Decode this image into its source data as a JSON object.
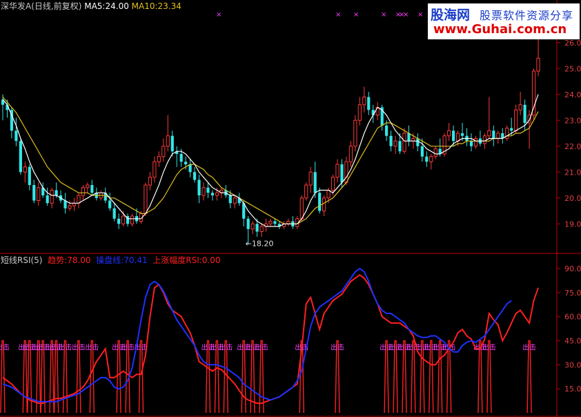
{
  "header": {
    "stock_name": "深华发A",
    "period": "(日线,前复权)",
    "ma5_label": "MA5:",
    "ma5_value": "24.00",
    "ma10_label": "MA10:",
    "ma10_value": "23.34"
  },
  "indicator_header": {
    "name": "短线RSI(5)",
    "trend_label": "趋势:",
    "trend_value": "78.00",
    "control_label": "操盘线:",
    "control_value": "70.41",
    "rise_label": "上涨幅度RSI:",
    "rise_value": "0.00"
  },
  "low_annotation": "←18.20",
  "exit_label": "出击",
  "logo": {
    "line1": "股海网",
    "line1b": "股票软件资源分享",
    "line2": "www.Guhai.com.cn"
  },
  "colors": {
    "up": "#ff3a3a",
    "down": "#33e6e6",
    "ma5": "#ffffff",
    "ma10": "#e0c020",
    "rsi_trend": "#ff2020",
    "rsi_control": "#2030ff",
    "exit_marker": "#ff40ff",
    "axis": "#c00000"
  },
  "chart_data": [
    {
      "type": "candlestick",
      "series": [
        {
          "name": "MA5",
          "value_label": "24.00"
        },
        {
          "name": "MA10",
          "value_label": "23.34"
        }
      ],
      "ylim": [
        18.1,
        26.9
      ],
      "y_ticks": [
        19.0,
        20.0,
        21.0,
        22.0,
        23.0,
        24.0,
        25.0,
        26.0
      ],
      "annotations": [
        {
          "text": "←18.20",
          "value": 18.2
        }
      ],
      "candles": [
        [
          23.8,
          24.0,
          23.0,
          23.6
        ],
        [
          23.6,
          23.8,
          23.1,
          23.4
        ],
        [
          23.4,
          23.5,
          22.3,
          22.6
        ],
        [
          22.6,
          23.1,
          22.0,
          22.2
        ],
        [
          22.2,
          22.3,
          20.9,
          21.0
        ],
        [
          21.0,
          21.4,
          20.6,
          21.2
        ],
        [
          21.2,
          21.3,
          20.3,
          20.5
        ],
        [
          20.5,
          20.7,
          19.8,
          19.9
        ],
        [
          19.9,
          20.6,
          19.7,
          20.4
        ],
        [
          20.4,
          20.6,
          20.0,
          20.1
        ],
        [
          20.1,
          20.4,
          19.7,
          19.8
        ],
        [
          19.8,
          20.4,
          19.6,
          20.3
        ],
        [
          20.3,
          20.6,
          20.0,
          20.1
        ],
        [
          20.1,
          20.3,
          19.8,
          19.9
        ],
        [
          19.9,
          20.2,
          19.4,
          19.6
        ],
        [
          19.6,
          19.9,
          19.5,
          19.7
        ],
        [
          19.7,
          20.0,
          19.5,
          19.8
        ],
        [
          19.8,
          20.2,
          19.6,
          20.1
        ],
        [
          20.1,
          20.5,
          19.9,
          20.4
        ],
        [
          20.4,
          20.6,
          20.2,
          20.5
        ],
        [
          20.5,
          20.7,
          20.1,
          20.2
        ],
        [
          20.2,
          20.4,
          19.9,
          20.0
        ],
        [
          20.0,
          20.3,
          19.9,
          20.2
        ],
        [
          20.2,
          20.4,
          19.8,
          19.9
        ],
        [
          19.9,
          20.2,
          19.5,
          19.6
        ],
        [
          19.6,
          19.8,
          19.1,
          19.2
        ],
        [
          19.2,
          19.4,
          18.8,
          19.0
        ],
        [
          19.0,
          19.5,
          18.9,
          19.3
        ],
        [
          19.3,
          19.4,
          18.9,
          19.0
        ],
        [
          19.0,
          19.4,
          18.9,
          19.3
        ],
        [
          19.3,
          19.6,
          19.0,
          19.1
        ],
        [
          19.1,
          19.5,
          19.0,
          19.4
        ],
        [
          19.4,
          20.6,
          19.3,
          20.5
        ],
        [
          20.5,
          21.0,
          20.3,
          20.8
        ],
        [
          20.8,
          21.6,
          20.6,
          21.4
        ],
        [
          21.4,
          21.8,
          21.2,
          21.6
        ],
        [
          21.6,
          22.3,
          21.4,
          22.0
        ],
        [
          22.0,
          23.2,
          21.8,
          22.4
        ],
        [
          22.4,
          22.6,
          21.6,
          21.8
        ],
        [
          21.8,
          22.0,
          21.2,
          21.7
        ],
        [
          21.7,
          21.9,
          21.2,
          21.4
        ],
        [
          21.4,
          21.6,
          21.1,
          21.3
        ],
        [
          21.3,
          21.5,
          20.8,
          21.0
        ],
        [
          21.0,
          21.2,
          20.6,
          20.7
        ],
        [
          20.7,
          20.9,
          19.8,
          20.1
        ],
        [
          20.1,
          20.6,
          19.9,
          20.4
        ],
        [
          20.4,
          20.6,
          20.0,
          20.2
        ],
        [
          20.2,
          20.3,
          19.9,
          20.1
        ],
        [
          20.1,
          20.4,
          19.9,
          20.2
        ],
        [
          20.2,
          20.4,
          20.0,
          20.3
        ],
        [
          20.3,
          20.5,
          20.0,
          20.1
        ],
        [
          20.1,
          20.3,
          19.6,
          19.8
        ],
        [
          19.8,
          20.1,
          19.6,
          20.0
        ],
        [
          20.0,
          20.2,
          19.7,
          19.8
        ],
        [
          19.8,
          19.9,
          18.9,
          19.2
        ],
        [
          19.2,
          19.3,
          18.2,
          18.8
        ],
        [
          18.8,
          19.1,
          18.6,
          19.0
        ],
        [
          19.0,
          19.2,
          18.5,
          18.7
        ],
        [
          18.7,
          19.0,
          18.5,
          18.9
        ],
        [
          18.9,
          19.2,
          18.7,
          19.0
        ],
        [
          19.0,
          19.2,
          18.9,
          19.1
        ],
        [
          19.1,
          19.2,
          18.9,
          19.0
        ],
        [
          19.0,
          19.1,
          18.8,
          18.9
        ],
        [
          18.9,
          19.1,
          18.8,
          19.0
        ],
        [
          19.0,
          19.2,
          18.9,
          19.1
        ],
        [
          19.1,
          19.3,
          18.8,
          18.9
        ],
        [
          18.9,
          19.3,
          18.8,
          19.2
        ],
        [
          19.2,
          20.1,
          19.1,
          20.0
        ],
        [
          20.0,
          20.6,
          19.9,
          20.5
        ],
        [
          20.5,
          21.2,
          20.2,
          21.0
        ],
        [
          21.0,
          21.4,
          20.0,
          20.2
        ],
        [
          20.2,
          20.4,
          19.4,
          19.5
        ],
        [
          19.5,
          20.1,
          19.3,
          20.0
        ],
        [
          20.0,
          20.4,
          19.8,
          20.3
        ],
        [
          20.3,
          20.9,
          20.1,
          20.8
        ],
        [
          20.8,
          21.5,
          20.6,
          21.3
        ],
        [
          21.3,
          21.5,
          20.4,
          20.6
        ],
        [
          20.6,
          21.6,
          20.5,
          21.4
        ],
        [
          21.4,
          22.2,
          21.2,
          22.0
        ],
        [
          22.0,
          23.2,
          21.8,
          23.0
        ],
        [
          23.0,
          23.9,
          22.8,
          23.6
        ],
        [
          23.6,
          24.3,
          23.3,
          23.9
        ],
        [
          23.9,
          24.1,
          23.2,
          23.4
        ],
        [
          23.4,
          23.6,
          22.9,
          23.2
        ],
        [
          23.2,
          23.7,
          23.0,
          23.5
        ],
        [
          23.5,
          23.6,
          22.6,
          22.8
        ],
        [
          22.8,
          23.0,
          22.2,
          22.4
        ],
        [
          22.4,
          22.6,
          21.8,
          22.0
        ],
        [
          22.0,
          22.4,
          21.7,
          22.2
        ],
        [
          22.2,
          22.5,
          21.7,
          21.8
        ],
        [
          21.8,
          22.7,
          21.7,
          22.5
        ],
        [
          22.5,
          22.8,
          22.0,
          22.2
        ],
        [
          22.2,
          22.5,
          21.9,
          22.3
        ],
        [
          22.3,
          22.5,
          21.8,
          22.0
        ],
        [
          22.0,
          22.3,
          21.4,
          21.6
        ],
        [
          21.6,
          21.8,
          21.2,
          21.4
        ],
        [
          21.4,
          21.7,
          21.1,
          21.6
        ],
        [
          21.6,
          22.0,
          21.5,
          21.9
        ],
        [
          21.9,
          22.3,
          21.6,
          21.7
        ],
        [
          21.7,
          22.5,
          21.6,
          22.4
        ],
        [
          22.4,
          22.9,
          22.2,
          22.6
        ],
        [
          22.6,
          22.8,
          22.0,
          22.2
        ],
        [
          22.2,
          22.6,
          22.0,
          22.5
        ],
        [
          22.5,
          22.9,
          22.2,
          22.4
        ],
        [
          22.4,
          22.7,
          22.0,
          22.2
        ],
        [
          22.2,
          22.5,
          21.8,
          22.0
        ],
        [
          22.0,
          22.4,
          21.9,
          22.3
        ],
        [
          22.3,
          22.6,
          22.0,
          22.1
        ],
        [
          22.1,
          22.5,
          21.9,
          22.4
        ],
        [
          22.4,
          23.9,
          22.3,
          22.6
        ],
        [
          22.6,
          22.8,
          22.0,
          22.3
        ],
        [
          22.3,
          22.6,
          22.1,
          22.5
        ],
        [
          22.5,
          22.7,
          22.1,
          22.3
        ],
        [
          22.3,
          22.8,
          22.2,
          22.7
        ],
        [
          22.7,
          23.1,
          22.4,
          22.6
        ],
        [
          22.6,
          23.6,
          22.5,
          23.4
        ],
        [
          23.4,
          24.1,
          23.2,
          23.6
        ],
        [
          23.6,
          23.8,
          22.6,
          22.9
        ],
        [
          22.9,
          23.4,
          21.9,
          23.2
        ],
        [
          23.2,
          25.0,
          23.0,
          24.9
        ],
        [
          24.9,
          26.9,
          24.7,
          25.4
        ]
      ],
      "ma5": [
        23.8,
        23.6,
        23.2,
        22.8,
        22.3,
        21.9,
        21.4,
        21.0,
        20.7,
        20.4,
        20.2,
        20.1,
        20.1,
        20.0,
        19.9,
        19.8,
        19.8,
        19.8,
        19.9,
        20.0,
        20.1,
        20.2,
        20.2,
        20.2,
        20.0,
        19.8,
        19.6,
        19.4,
        19.2,
        19.2,
        19.2,
        19.2,
        19.4,
        19.7,
        20.1,
        20.5,
        21.0,
        21.4,
        21.7,
        21.8,
        21.8,
        21.7,
        21.5,
        21.3,
        21.0,
        20.8,
        20.6,
        20.4,
        20.3,
        20.2,
        20.2,
        20.1,
        20.1,
        20.0,
        19.8,
        19.5,
        19.3,
        19.1,
        19.0,
        18.9,
        18.9,
        18.9,
        18.9,
        19.0,
        19.0,
        19.0,
        19.0,
        19.2,
        19.5,
        19.9,
        20.2,
        20.3,
        20.3,
        20.3,
        20.2,
        20.4,
        20.6,
        20.8,
        21.1,
        21.5,
        22.0,
        22.5,
        22.9,
        23.2,
        23.5,
        23.4,
        23.2,
        22.9,
        22.6,
        22.4,
        22.2,
        22.2,
        22.2,
        22.2,
        22.1,
        21.9,
        21.8,
        21.7,
        21.7,
        21.8,
        21.9,
        22.1,
        22.2,
        22.3,
        22.3,
        22.3,
        22.2,
        22.2,
        22.2,
        22.3,
        22.3,
        22.3,
        22.3,
        22.4,
        22.5,
        22.6,
        22.7,
        22.8,
        23.0,
        23.5,
        24.0
      ],
      "ma10": [
        23.9,
        23.7,
        23.5,
        23.3,
        23.0,
        22.7,
        22.4,
        22.1,
        21.8,
        21.5,
        21.2,
        21.0,
        20.8,
        20.6,
        20.5,
        20.4,
        20.3,
        20.2,
        20.2,
        20.2,
        20.1,
        20.1,
        20.1,
        20.1,
        20.0,
        20.0,
        19.9,
        19.8,
        19.7,
        19.6,
        19.5,
        19.4,
        19.4,
        19.5,
        19.6,
        19.8,
        20.0,
        20.3,
        20.6,
        20.9,
        21.1,
        21.2,
        21.3,
        21.3,
        21.2,
        21.1,
        20.9,
        20.8,
        20.6,
        20.4,
        20.3,
        20.2,
        20.1,
        20.0,
        19.9,
        19.8,
        19.7,
        19.6,
        19.5,
        19.4,
        19.3,
        19.2,
        19.1,
        19.0,
        19.0,
        19.0,
        19.0,
        19.1,
        19.2,
        19.4,
        19.6,
        19.7,
        19.8,
        19.9,
        20.0,
        20.2,
        20.4,
        20.6,
        20.9,
        21.2,
        21.5,
        21.8,
        22.1,
        22.4,
        22.7,
        22.8,
        22.9,
        22.9,
        22.8,
        22.7,
        22.6,
        22.5,
        22.4,
        22.3,
        22.2,
        22.1,
        22.0,
        22.0,
        22.0,
        22.0,
        22.0,
        22.0,
        22.1,
        22.1,
        22.2,
        22.2,
        22.2,
        22.2,
        22.2,
        22.2,
        22.3,
        22.3,
        22.3,
        22.4,
        22.4,
        22.5,
        22.5,
        22.6,
        22.7,
        23.0,
        23.34
      ]
    },
    {
      "type": "line",
      "ylim": [
        0,
        93
      ],
      "y_ticks": [
        15.0,
        30.0,
        45.0,
        60.0,
        75.0,
        90.0
      ],
      "series": [
        {
          "name": "趋势",
          "color": "#ff2020",
          "values": [
            22,
            20,
            18,
            15,
            12,
            10,
            8,
            7,
            6,
            6,
            7,
            8,
            9,
            9,
            10,
            11,
            12,
            14,
            16,
            20,
            26,
            32,
            36,
            40,
            22,
            22,
            24,
            26,
            24,
            22,
            24,
            24,
            36,
            60,
            78,
            80,
            75,
            68,
            64,
            62,
            60,
            55,
            50,
            42,
            32,
            30,
            28,
            26,
            28,
            27,
            24,
            21,
            18,
            14,
            10,
            8,
            7,
            6,
            6,
            7,
            8,
            9,
            10,
            12,
            14,
            16,
            18,
            40,
            68,
            72,
            62,
            52,
            62,
            66,
            70,
            72,
            74,
            78,
            82,
            84,
            86,
            84,
            80,
            74,
            68,
            60,
            58,
            56,
            56,
            56,
            54,
            52,
            48,
            38,
            34,
            32,
            30,
            30,
            34,
            36,
            40,
            44,
            50,
            52,
            48,
            46,
            40,
            40,
            46,
            62,
            58,
            55,
            45,
            50,
            56,
            62,
            64,
            60,
            56,
            70,
            78
          ]
        },
        {
          "name": "操盘线",
          "color": "#2030ff",
          "values": [
            18,
            17,
            16,
            14,
            12,
            10,
            9,
            8,
            7,
            7,
            7,
            7,
            7,
            8,
            9,
            10,
            11,
            12,
            14,
            16,
            18,
            20,
            22,
            22,
            20,
            16,
            15,
            16,
            20,
            28,
            42,
            58,
            72,
            80,
            82,
            80,
            76,
            70,
            64,
            58,
            54,
            50,
            46,
            42,
            36,
            32,
            30,
            30,
            30,
            29,
            28,
            26,
            24,
            22,
            18,
            16,
            14,
            12,
            10,
            9,
            8,
            9,
            10,
            12,
            14,
            16,
            20,
            26,
            40,
            54,
            62,
            66,
            68,
            70,
            72,
            74,
            76,
            80,
            84,
            88,
            90,
            88,
            82,
            74,
            68,
            64,
            62,
            62,
            60,
            58,
            56,
            52,
            50,
            48,
            47,
            47,
            48,
            48,
            46,
            44,
            40,
            38,
            38,
            42,
            44,
            45,
            44,
            46,
            48,
            52,
            56,
            60,
            64,
            68,
            70
          ]
        }
      ],
      "exit_markers": [
        {
          "value": 45,
          "label": "出击"
        }
      ]
    }
  ]
}
